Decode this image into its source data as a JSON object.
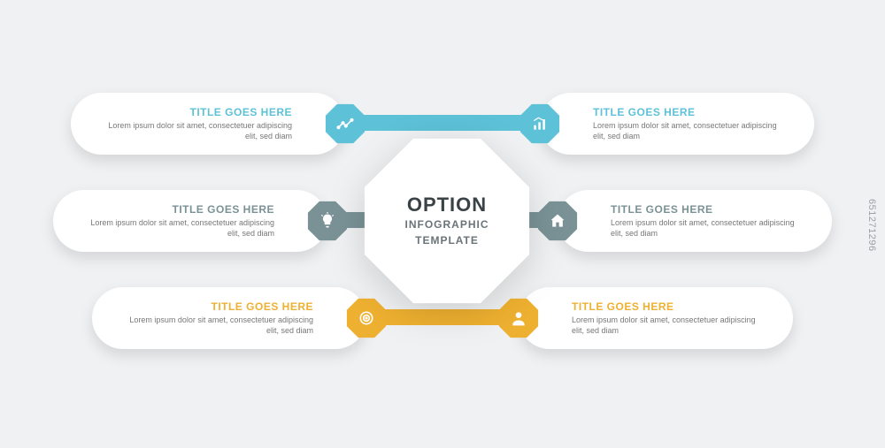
{
  "center": {
    "title": "OPTION",
    "line1": "INFOGRAPHIC",
    "line2": "TEMPLATE"
  },
  "colors": {
    "blue": "#5dc1d8",
    "slate": "#7a9296",
    "gold": "#eeb030"
  },
  "items": {
    "l1": {
      "title": "TITLE GOES HERE",
      "desc": "Lorem ipsum dolor sit amet, consectetuer adipiscing elit, sed diam"
    },
    "l2": {
      "title": "TITLE GOES HERE",
      "desc": "Lorem ipsum dolor sit amet, consectetuer adipiscing elit, sed diam"
    },
    "l3": {
      "title": "TITLE GOES HERE",
      "desc": "Lorem ipsum dolor sit amet, consectetuer adipiscing elit, sed diam"
    },
    "r1": {
      "title": "TITLE GOES HERE",
      "desc": "Lorem ipsum dolor sit amet, consectetuer adipiscing elit, sed diam"
    },
    "r2": {
      "title": "TITLE GOES HERE",
      "desc": "Lorem ipsum dolor sit amet, consectetuer adipiscing elit, sed diam"
    },
    "r3": {
      "title": "TITLE GOES HERE",
      "desc": "Lorem ipsum dolor sit amet, consectetuer adipiscing elit, sed diam"
    }
  },
  "watermark": "651271296"
}
